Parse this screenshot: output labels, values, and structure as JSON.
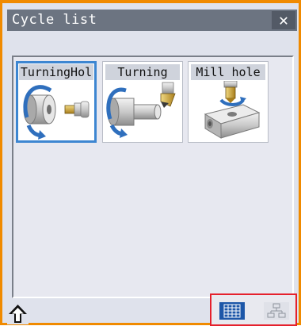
{
  "window": {
    "title": "Cycle list",
    "close_symbol": "✕"
  },
  "cycles": [
    {
      "label": "TurningHol",
      "icon": "turning-hole-icon",
      "selected": true
    },
    {
      "label": "Turning",
      "icon": "turning-icon",
      "selected": false
    },
    {
      "label": "Mill hole",
      "icon": "mill-hole-icon",
      "selected": false
    }
  ],
  "footer": {
    "up_icon": "up-arrow-icon",
    "view_modes": [
      {
        "name": "grid-view",
        "icon": "grid-icon",
        "active": true
      },
      {
        "name": "tree-view",
        "icon": "tree-icon",
        "active": false
      }
    ]
  },
  "colors": {
    "accent_border": "#f08a00",
    "selection": "#3d86d1",
    "view_group_outline": "#e5202c",
    "active_view": "#1d57a8"
  }
}
